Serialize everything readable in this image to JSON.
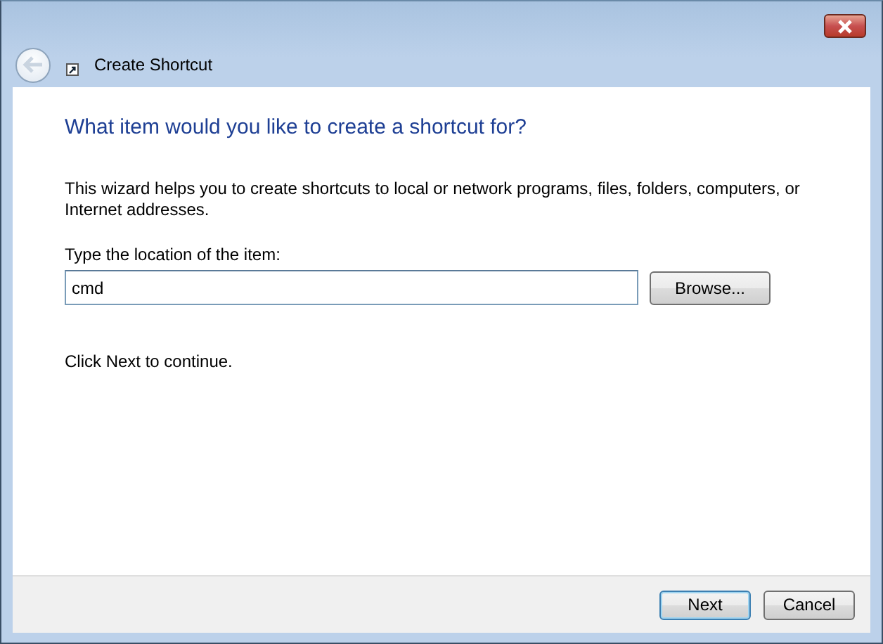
{
  "window": {
    "title": "Create Shortcut",
    "back_disabled": true
  },
  "heading": "What item would you like to create a shortcut for?",
  "description": "This wizard helps you to create shortcuts to local or network programs, files, folders, computers, or Internet addresses.",
  "location": {
    "label": "Type the location of the item:",
    "value": "cmd",
    "browse": "Browse..."
  },
  "hint": "Click Next to continue.",
  "buttons": [
    {
      "label": "Next",
      "default": true
    },
    {
      "label": "Cancel",
      "default": false
    }
  ]
}
